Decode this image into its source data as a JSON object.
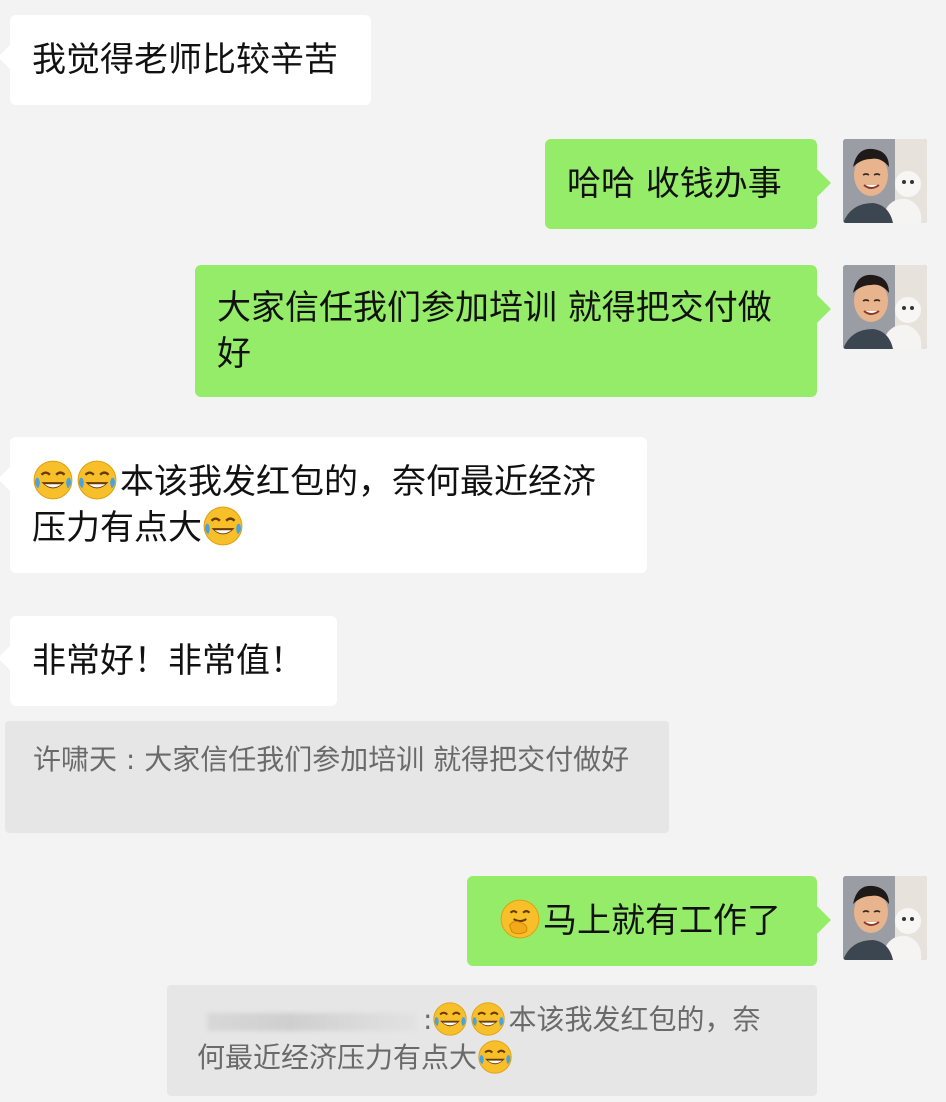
{
  "messages": [
    {
      "text": "我觉得老师比较辛苦"
    },
    {
      "text": "哈哈 收钱办事"
    },
    {
      "text": "大家信任我们参加培训 就得把交付做好"
    },
    {
      "text_a": "本该我发红包的，奈何最近经济",
      "text_b": "压力有点大"
    },
    {
      "text": "非常好！非常值！"
    },
    {
      "quote": "许啸天 : 大家信任我们参加培训 就得把交付做好"
    },
    {
      "text": "马上就有工作了"
    },
    {
      "quote_sep": ":",
      "quote_a": "本该我发红包的，奈",
      "quote_b": "何最近经济压力有点大"
    }
  ],
  "icons": {
    "laugh": "face-with-tears-of-joy-icon",
    "giggle": "face-with-hand-over-mouth-icon",
    "avatar": "user-avatar"
  },
  "colors": {
    "background": "#f3f3f3",
    "outgoing": "#95ec69",
    "incoming": "#ffffff",
    "quote": "#e6e6e6"
  }
}
